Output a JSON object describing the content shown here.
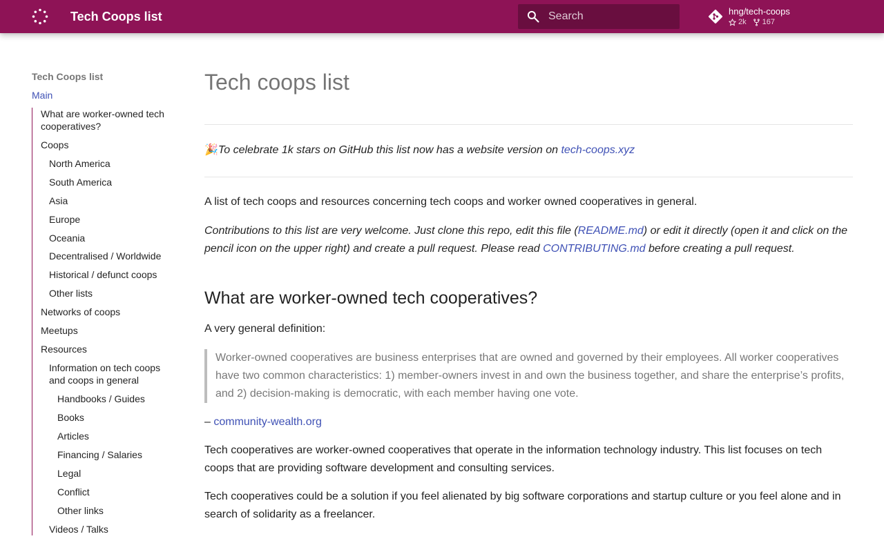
{
  "header": {
    "logo_icon": "dotted-circle-icon",
    "title": "Tech Coops list",
    "search_placeholder": "Search",
    "repo": {
      "icon": "git-icon",
      "name": "hng/tech-coops",
      "stars": "2k",
      "forks": "167"
    },
    "colors": {
      "primary": "#8e1356",
      "link": "#3f51b5"
    }
  },
  "nav": {
    "title": "Tech Coops list",
    "main": "Main",
    "items": [
      {
        "label": "What are worker-owned tech cooperatives?"
      },
      {
        "label": "Coops"
      },
      {
        "label": "North America"
      },
      {
        "label": "South America"
      },
      {
        "label": "Asia"
      },
      {
        "label": "Europe"
      },
      {
        "label": "Oceania"
      },
      {
        "label": "Decentralised / Worldwide"
      },
      {
        "label": "Historical / defunct coops"
      },
      {
        "label": "Other lists"
      },
      {
        "label": "Networks of coops"
      },
      {
        "label": "Meetups"
      },
      {
        "label": "Resources"
      },
      {
        "label": "Information on tech coops and coops in general"
      },
      {
        "label": "Handbooks / Guides"
      },
      {
        "label": "Books"
      },
      {
        "label": "Articles"
      },
      {
        "label": "Financing / Salaries"
      },
      {
        "label": "Legal"
      },
      {
        "label": "Conflict"
      },
      {
        "label": "Other links"
      },
      {
        "label": "Videos / Talks"
      }
    ]
  },
  "content": {
    "title": "Tech coops list",
    "celebrate": {
      "emoji": "🎉",
      "text": "To celebrate 1k stars on GitHub this list now has a website version on ",
      "link": "tech-coops.xyz"
    },
    "intro": "A list of tech coops and resources concerning tech coops and worker owned cooperatives in general.",
    "contrib": {
      "part1": "Contributions to this list are very welcome. Just clone this repo, edit this file (",
      "link1": "README.md",
      "part2": ") or edit it directly (open it and click on the pencil icon on the upper right) and create a pull request. Please read ",
      "link2": "CONTRIBUTING.md",
      "part3": " before creating a pull request."
    },
    "section_heading": "What are worker-owned tech cooperatives?",
    "definition_intro": "A very general definition:",
    "quote": "Worker-owned cooperatives are business enterprises that are owned and governed by their employees. All worker cooperatives have two common characteristics: 1) member-owners invest in and own the business together, and share the enterprise’s profits, and 2) decision-making is democratic, with each member having one vote.",
    "attribution_dash": "– ",
    "attribution_link": "community-wealth.org",
    "para1": "Tech cooperatives are worker-owned cooperatives that operate in the information technology industry. This list focuses on tech coops that are providing software development and consulting services.",
    "para2": "Tech cooperatives could be a solution if you feel alienated by big software corporations and startup culture or you feel alone and in search of solidarity as a freelancer."
  }
}
